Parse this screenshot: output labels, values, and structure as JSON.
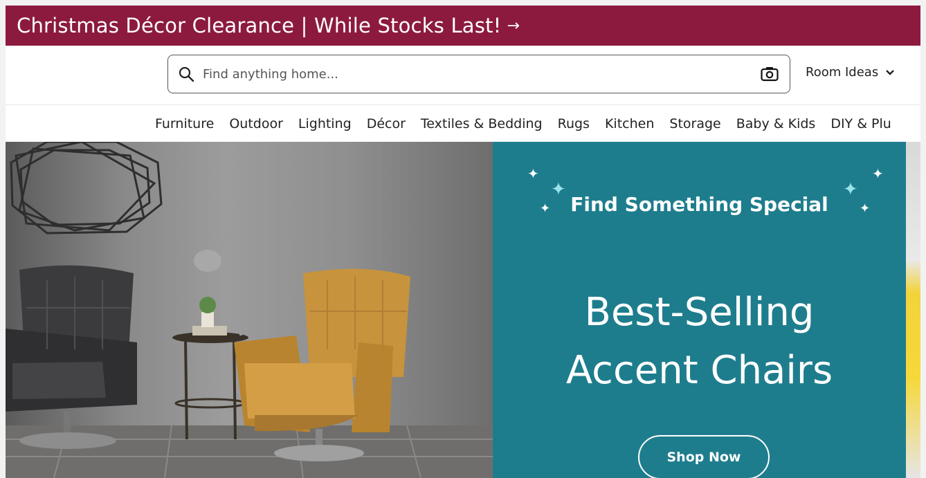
{
  "promo": {
    "text": "Christmas Décor Clearance | While Stocks Last!",
    "arrow": "→"
  },
  "search": {
    "placeholder": "Find anything home...",
    "search_icon": "search-icon",
    "camera_icon": "camera-icon"
  },
  "room_ideas": {
    "label": "Room Ideas",
    "icon": "chevron-down-icon"
  },
  "categories": [
    "Furniture",
    "Outdoor",
    "Lighting",
    "Décor",
    "Textiles & Bedding",
    "Rugs",
    "Kitchen",
    "Storage",
    "Baby & Kids",
    "DIY & Plu"
  ],
  "hero": {
    "kicker": "Find Something Special",
    "headline_line1": "Best-Selling",
    "headline_line2": "Accent Chairs",
    "cta": "Shop Now"
  },
  "colors": {
    "promo_bg": "#8c1a3f",
    "panel_bg": "#1e7d8d"
  }
}
